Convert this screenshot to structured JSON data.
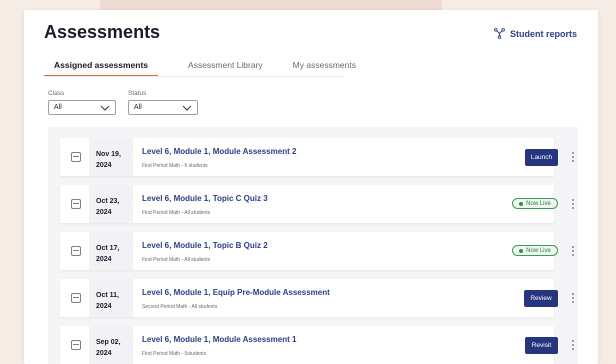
{
  "header": {
    "title": "Assessments",
    "reports_label": "Student reports"
  },
  "tabs": [
    {
      "label": "Assigned assessments",
      "active": true
    },
    {
      "label": "Assessment Library",
      "active": false
    },
    {
      "label": "My assessments",
      "active": false
    }
  ],
  "filters": {
    "class": {
      "label": "Class",
      "value": "All"
    },
    "status": {
      "label": "Status",
      "value": "All"
    }
  },
  "rows": [
    {
      "date_line1": "Nov 19,",
      "date_line2": "2024",
      "title": "Level 6, Module 1, Module Assessment 2",
      "subtitle": "First Period Math - 6 students",
      "action": "Launch"
    },
    {
      "date_line1": "Oct 23,",
      "date_line2": "2024",
      "title": "Level 6, Module 1, Topic C Quiz 3",
      "subtitle": "First Period Math - All students",
      "status": "Now Live"
    },
    {
      "date_line1": "Oct 17,",
      "date_line2": "2024",
      "title": "Level 6, Module 1, Topic B Quiz 2",
      "subtitle": "First Period Math - All students",
      "status": "Now Live"
    },
    {
      "date_line1": "Oct 11,",
      "date_line2": "2024",
      "title": "Level 6, Module 1, Equip Pre-Module Assessment",
      "subtitle": "Second Period Math - All students",
      "action": "Review"
    },
    {
      "date_line1": "Sep 02,",
      "date_line2": "2024",
      "title": "Level 6, Module 1, Module Assessment 1",
      "subtitle": "First Period Math - 5students",
      "action": "Revisit"
    }
  ],
  "colors": {
    "accent": "#27347f",
    "tab_indicator": "#e06a3a",
    "live": "#2f8f4f"
  }
}
